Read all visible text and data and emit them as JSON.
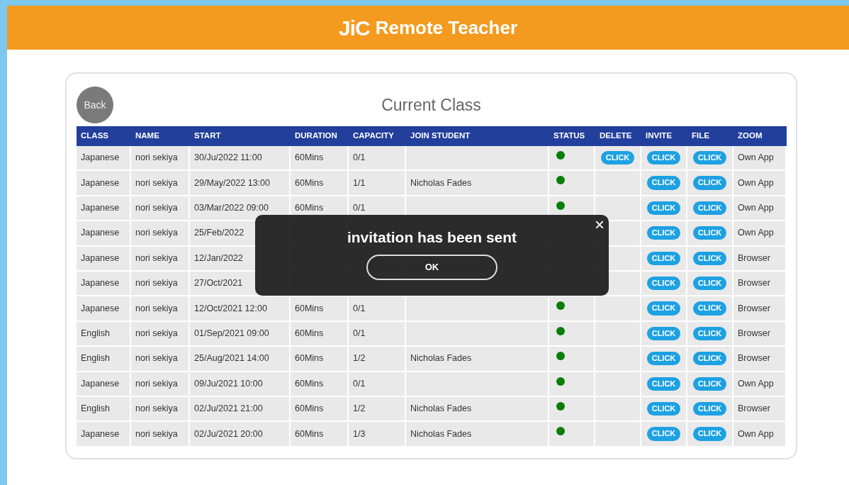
{
  "header": {
    "logo": "JiC",
    "title": "Remote Teacher"
  },
  "back_button": "Back",
  "page_title": "Current Class",
  "table": {
    "columns": [
      "CLASS",
      "NAME",
      "START",
      "DURATION",
      "CAPACITY",
      "JOIN STUDENT",
      "STATUS",
      "DELETE",
      "INVITE",
      "FILE",
      "ZOOM"
    ],
    "rows": [
      {
        "class": "Japanese",
        "name": "nori sekiya",
        "start": "30/Ju/2022 11:00",
        "duration": "60Mins",
        "capacity": "0/1",
        "active": true,
        "delete": "CLICK",
        "invite": "CLICK",
        "file": "CLICK",
        "zoom": "Own App"
      },
      {
        "class": "Japanese",
        "name": "nori sekiya",
        "start": "29/May/2022 13:00",
        "duration": "60Mins",
        "capacity": "1/1",
        "join_student": "Nicholas Fades",
        "active": true,
        "invite": "CLICK",
        "file": "CLICK",
        "zoom": "Own App"
      },
      {
        "class": "Japanese",
        "name": "nori sekiya",
        "start": "03/Mar/2022 09:00",
        "duration": "60Mins",
        "capacity": "0/1",
        "active": true,
        "invite": "CLICK",
        "file": "CLICK",
        "zoom": "Own App"
      },
      {
        "class": "Japanese",
        "name": "nori sekiya",
        "start": "25/Feb/2022",
        "invite": "CLICK",
        "file": "CLICK",
        "zoom": "Own App"
      },
      {
        "class": "Japanese",
        "name": "nori sekiya",
        "start": "12/Jan/2022",
        "invite": "CLICK",
        "file": "CLICK",
        "zoom": "Browser"
      },
      {
        "class": "Japanese",
        "name": "nori sekiya",
        "start": "27/Oct/2021",
        "invite": "CLICK",
        "file": "CLICK",
        "zoom": "Browser"
      },
      {
        "class": "Japanese",
        "name": "nori sekiya",
        "start": "12/Oct/2021 12:00",
        "duration": "60Mins",
        "capacity": "0/1",
        "active": true,
        "invite": "CLICK",
        "file": "CLICK",
        "zoom": "Browser"
      },
      {
        "class": "English",
        "name": "nori sekiya",
        "start": "01/Sep/2021 09:00",
        "duration": "60Mins",
        "capacity": "0/1",
        "active": true,
        "invite": "CLICK",
        "file": "CLICK",
        "zoom": "Browser"
      },
      {
        "class": "English",
        "name": "nori sekiya",
        "start": "25/Aug/2021 14:00",
        "duration": "60Mins",
        "capacity": "1/2",
        "join_student": "Nicholas Fades",
        "active": true,
        "invite": "CLICK",
        "file": "CLICK",
        "zoom": "Browser"
      },
      {
        "class": "Japanese",
        "name": "nori sekiya",
        "start": "09/Ju/2021 10:00",
        "duration": "60Mins",
        "capacity": "0/1",
        "active": true,
        "invite": "CLICK",
        "file": "CLICK",
        "zoom": "Own App"
      },
      {
        "class": "English",
        "name": "nori sekiya",
        "start": "02/Ju/2021 21:00",
        "duration": "60Mins",
        "capacity": "1/2",
        "join_student": "Nicholas Fades",
        "active": true,
        "invite": "CLICK",
        "file": "CLICK",
        "zoom": "Browser"
      },
      {
        "class": "Japanese",
        "name": "nori sekiya",
        "start": "02/Ju/2021 20:00",
        "duration": "60Mins",
        "capacity": "1/3",
        "join_student": "Nicholas Fades",
        "active": true,
        "invite": "CLICK",
        "file": "CLICK",
        "zoom": "Own App"
      }
    ]
  },
  "dialog": {
    "message": "invitation has been sent",
    "ok_button": "OK",
    "close": "×"
  }
}
